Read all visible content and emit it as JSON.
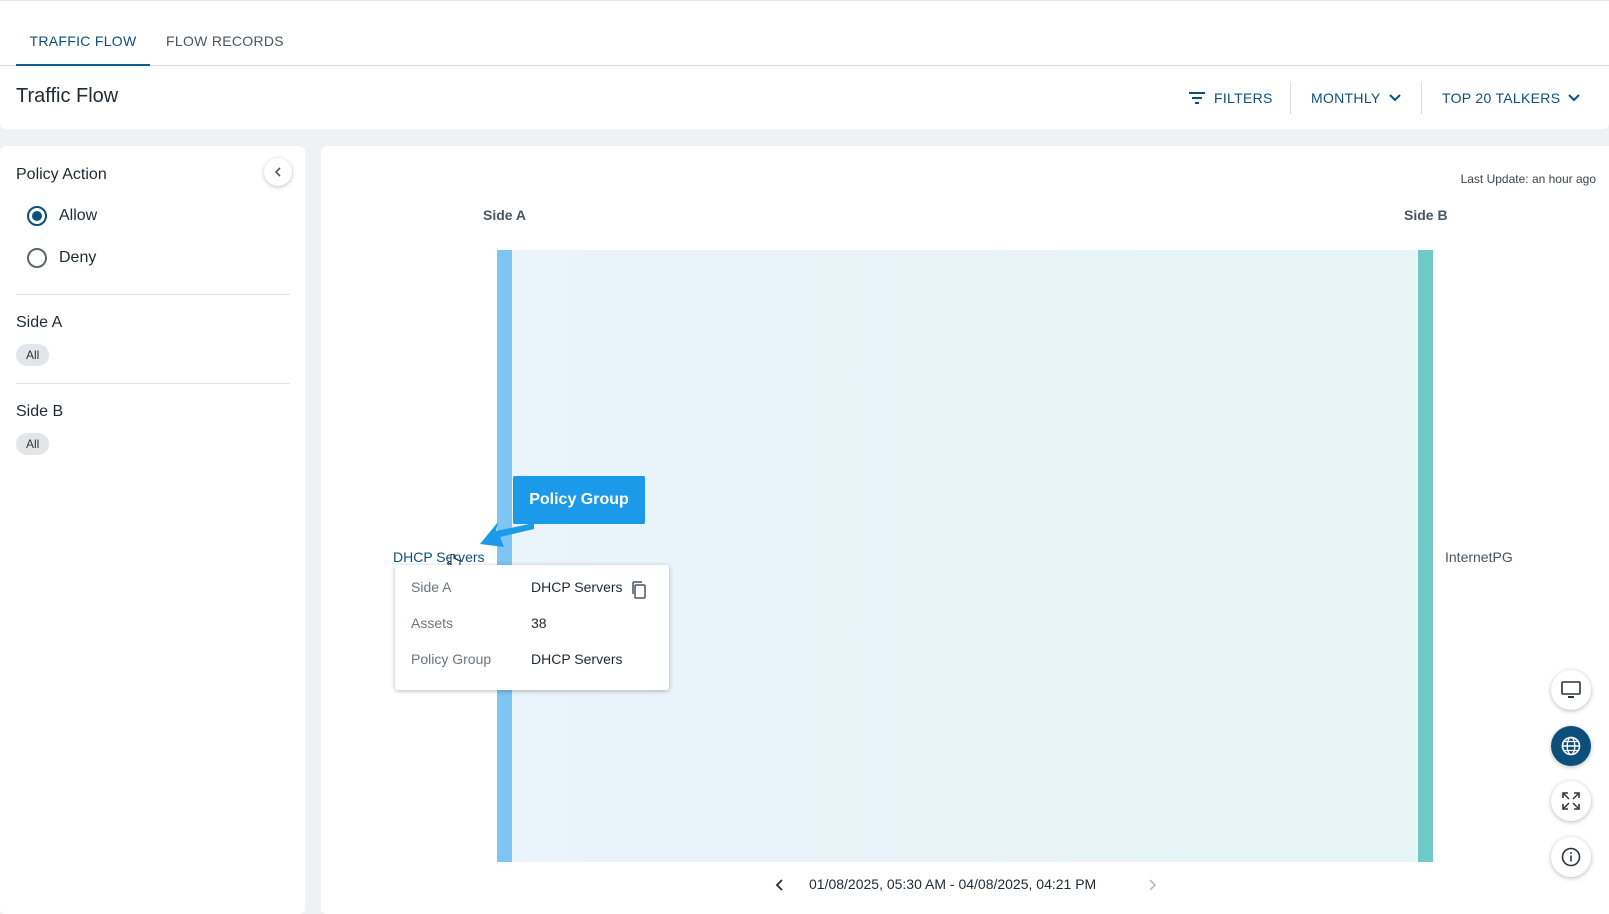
{
  "tabs": [
    {
      "label": "TRAFFIC FLOW",
      "active": true
    },
    {
      "label": "FLOW RECORDS",
      "active": false
    }
  ],
  "header": {
    "title": "Traffic Flow",
    "filters_label": "FILTERS",
    "period_label": "MONTHLY",
    "talkers_label": "TOP 20 TALKERS"
  },
  "sidebar": {
    "policy_action_title": "Policy Action",
    "options": [
      {
        "label": "Allow",
        "checked": true
      },
      {
        "label": "Deny",
        "checked": false
      }
    ],
    "side_a_title": "Side A",
    "side_a_chip": "All",
    "side_b_title": "Side B",
    "side_b_chip": "All"
  },
  "chart": {
    "last_update": "Last Update: an hour ago",
    "side_a_label": "Side A",
    "side_b_label": "Side B",
    "node_a": "DHCP Servers",
    "node_b": "InternetPG",
    "callout": "Policy Group",
    "tooltip": [
      {
        "key": "Side A",
        "value": "DHCP Servers"
      },
      {
        "key": "Assets",
        "value": "38"
      },
      {
        "key": "Policy Group",
        "value": "DHCP Servers"
      }
    ],
    "date_range": "01/08/2025, 05:30 AM - 04/08/2025, 04:21 PM"
  },
  "colors": {
    "accent": "#0d4f7c",
    "callout": "#1a9ae8",
    "side_a_bar": "#7ec4f5",
    "side_b_bar": "#6fcac7"
  }
}
